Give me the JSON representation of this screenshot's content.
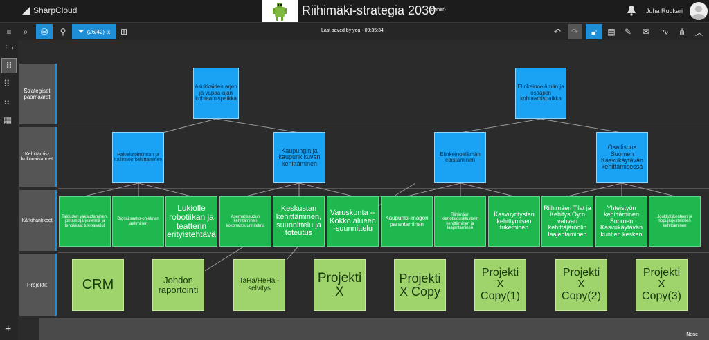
{
  "app": {
    "brand": "SharpCloud",
    "title": "Riihimäki-strategia 2030",
    "owner": "(owner)",
    "user": "Juha Ruokari"
  },
  "toolbar": {
    "filter": "(26/42)",
    "filter_close": "x",
    "saved": "Last saved by you - 09:35:34"
  },
  "rows": [
    {
      "label": "Strategiset päämäärät"
    },
    {
      "label": "Kehittämis-kokonaisuudet"
    },
    {
      "label": "Kärkihankkeet"
    },
    {
      "label": "Projektit"
    }
  ],
  "strategic": [
    {
      "label": "Asukkaiden arjen ja vapaa-ajan kohtaamispaikka"
    },
    {
      "label": "Elinkeinoelämän ja osaajien kohtaamispaikka"
    }
  ],
  "development": [
    {
      "label": "Palvelutoiminnan ja hallinnon kehittäminen"
    },
    {
      "label": "Kaupungin ja kaupunkikuvan kehittäminen"
    },
    {
      "label": "Elinkeinoelämän edistäminen"
    },
    {
      "label": "Osallisuus Suomen Kasvukäytävän kehittämisessä"
    }
  ],
  "flagship": [
    {
      "label": "Talouden vakauttaminen, johtamisjärjestelmä ja tehokkaat tukipalvelut"
    },
    {
      "label": "Digitalisaatio-ohjelman laatiminen"
    },
    {
      "label": "Lukiolle robotiikan ja teatterin erityistehtävä"
    },
    {
      "label": "Asemanseudun kehittäminen kokonaissuunnitelma"
    },
    {
      "label": "Keskustan kehittäminen, suunnittelu ja toteutus"
    },
    {
      "label": "Varuskunta -- Kokko alueen -suunnittelu"
    },
    {
      "label": "Kaupunki-imagon parantaminen"
    },
    {
      "label": "Riihimäen kiertotalousklusterin kehittäminen ja laajentaminen"
    },
    {
      "label": "Kasvuyritysten kehittymisen tukeminen"
    },
    {
      "label": "Riihimäen Tilat ja Kehitys Oy:n vahvan kehittäjäroolin laajentaminen"
    },
    {
      "label": "Yhteistyön kehittäminen Suomen Kasvukäytävän kuntien kesken"
    },
    {
      "label": "Joukkoliikenteen ja lippujärjestelmien kehittäminen"
    }
  ],
  "projects": [
    {
      "label": "CRM"
    },
    {
      "label": "Johdon raportointi"
    },
    {
      "label": "TaHa/HeHa -selvitys"
    },
    {
      "label": "Projekti X"
    },
    {
      "label": "Projekti X Copy"
    },
    {
      "label": "Projekti X Copy(1)"
    },
    {
      "label": "Projekti X Copy(2)"
    },
    {
      "label": "Projekti X Copy(3)"
    }
  ],
  "footer": {
    "none": "None"
  },
  "colors": {
    "accent": "#1e8fd6",
    "strategic": "#1aa3f5",
    "flagship": "#1fb84f",
    "project": "#9fd36b"
  }
}
